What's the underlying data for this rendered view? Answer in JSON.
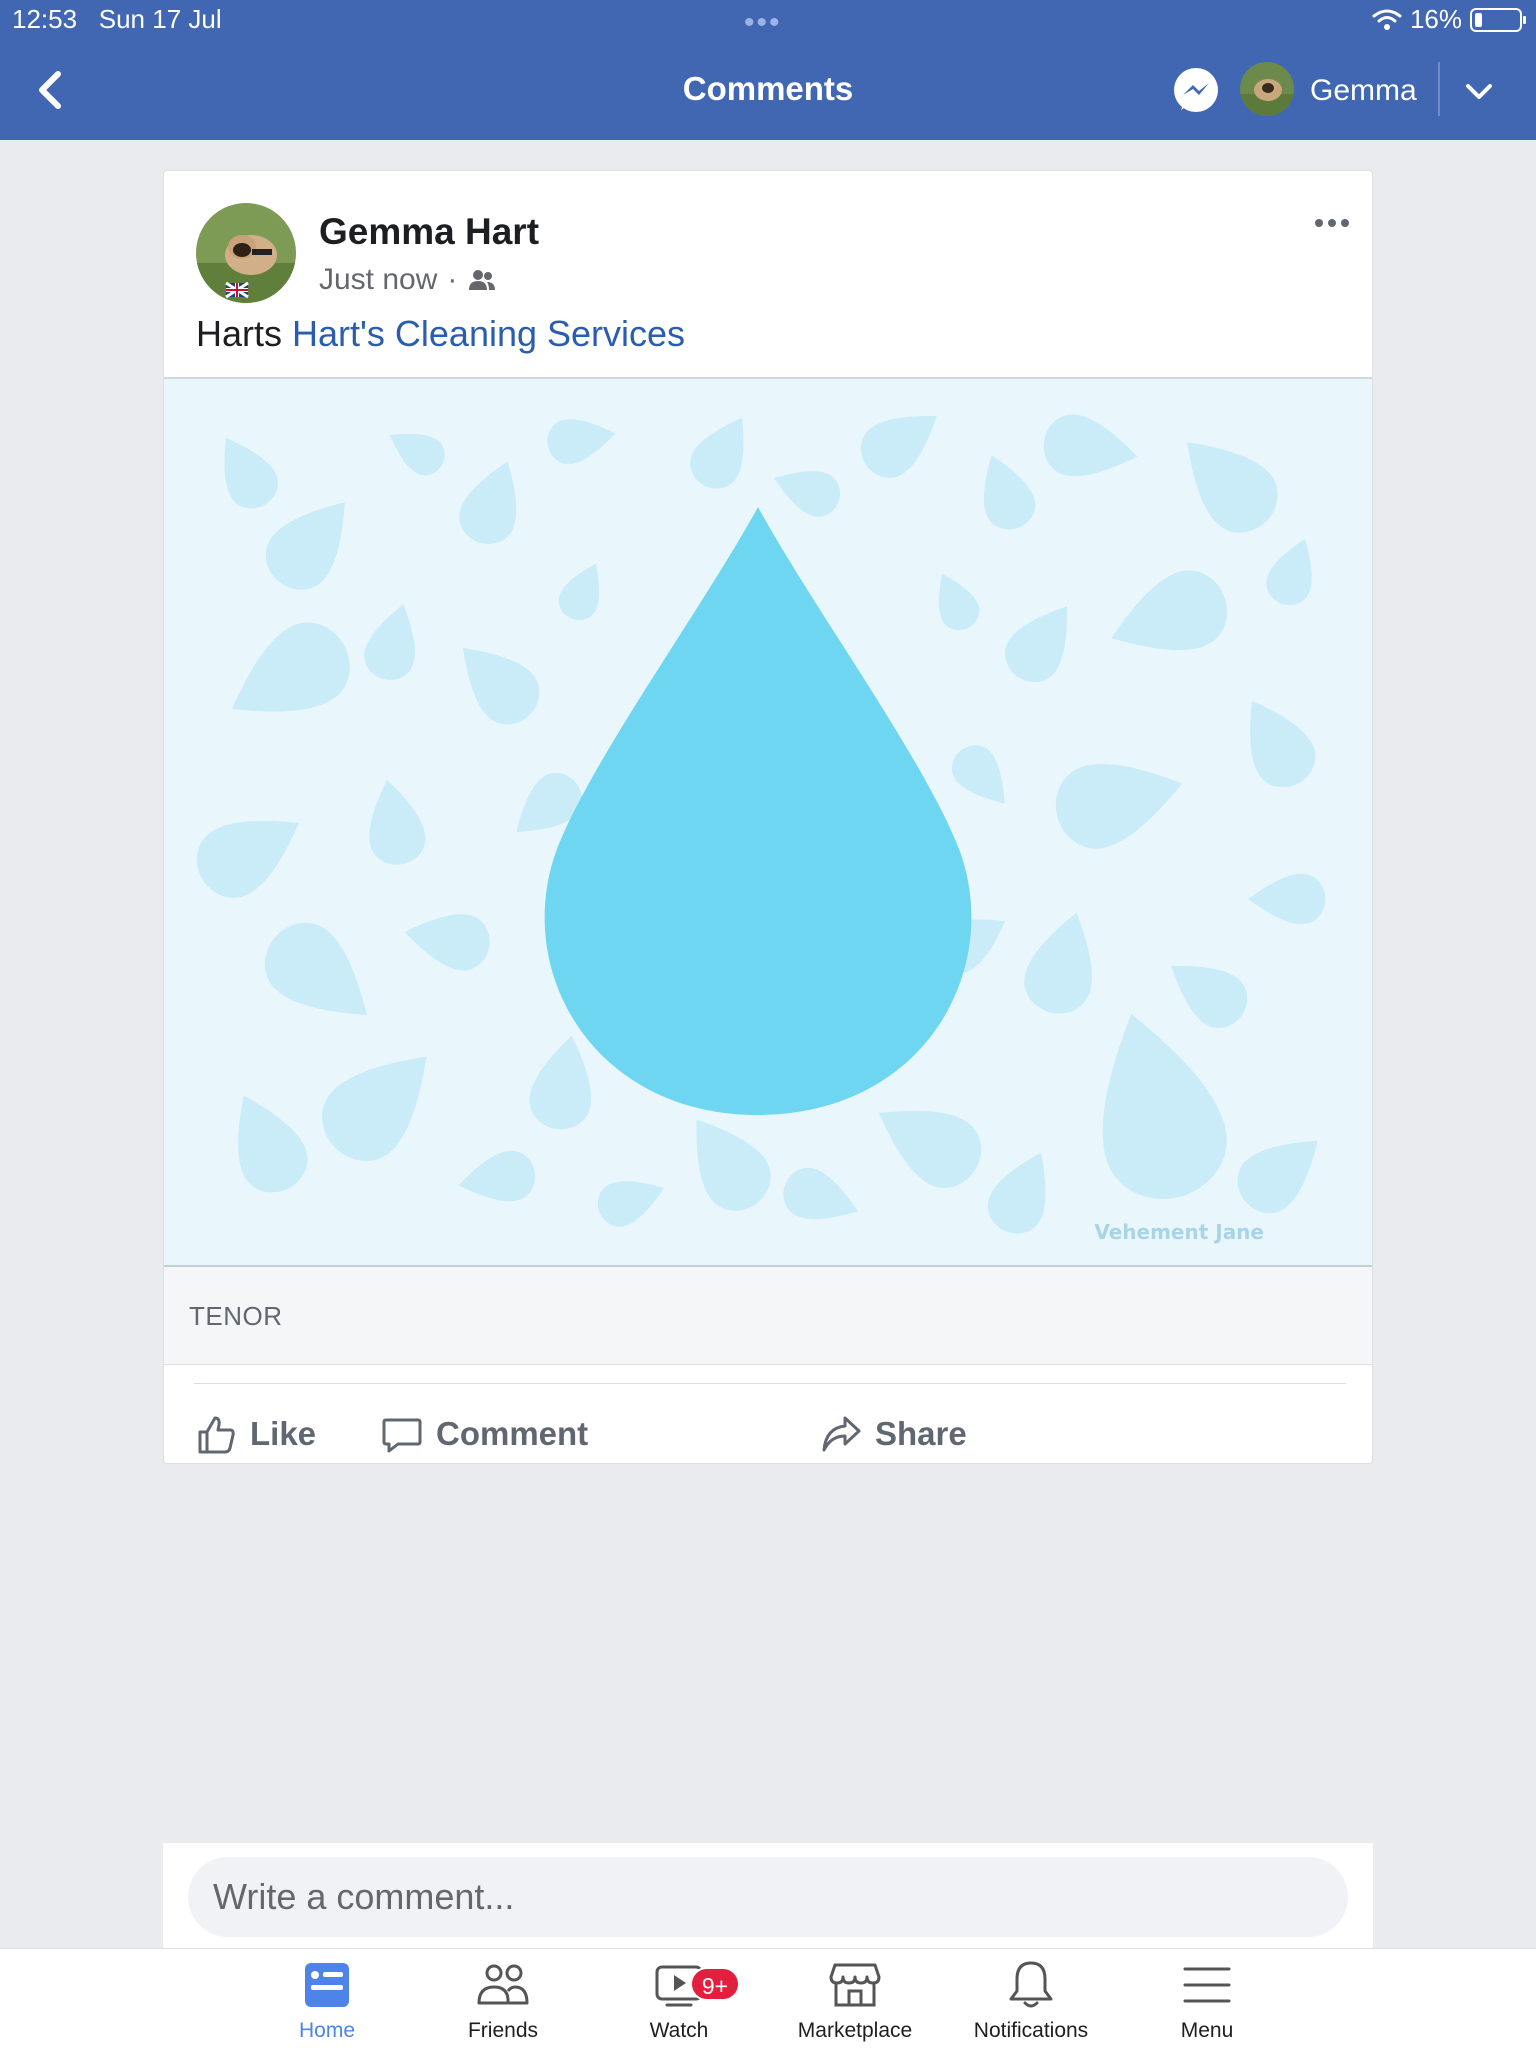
{
  "status_bar": {
    "time": "12:53",
    "date": "Sun 17 Jul",
    "battery": "16%"
  },
  "nav": {
    "title": "Comments",
    "user_name": "Gemma",
    "icons": [
      "back-chevron-icon",
      "messenger-icon",
      "chevron-down-icon"
    ]
  },
  "post": {
    "author": "Gemma Hart",
    "timestamp": "Just now",
    "separator": "·",
    "audience_icon": "friends-icon",
    "text_prefix": "Harts",
    "tagged_page": "Hart's Cleaning Services",
    "media_signature": "Vehement Jane",
    "attribution": "TENOR",
    "actions": {
      "like": "Like",
      "comment": "Comment",
      "share": "Share"
    }
  },
  "composer": {
    "placeholder": "Write a comment..."
  },
  "tabs": [
    {
      "label": "Home",
      "icon": "home-icon",
      "active": true
    },
    {
      "label": "Friends",
      "icon": "friends-icon",
      "active": false
    },
    {
      "label": "Watch",
      "icon": "watch-icon",
      "badge": "9+",
      "active": false
    },
    {
      "label": "Marketplace",
      "icon": "marketplace-icon",
      "active": false
    },
    {
      "label": "Notifications",
      "icon": "bell-icon",
      "active": false
    },
    {
      "label": "Menu",
      "icon": "menu-icon",
      "active": false
    }
  ],
  "colors": {
    "header": "#4267b2",
    "link": "#2a5db0",
    "active_tab": "#4e84ea",
    "badge": "#e41e3f",
    "drop": "#6fd6f2",
    "drop_background": "#e9f7fd"
  }
}
